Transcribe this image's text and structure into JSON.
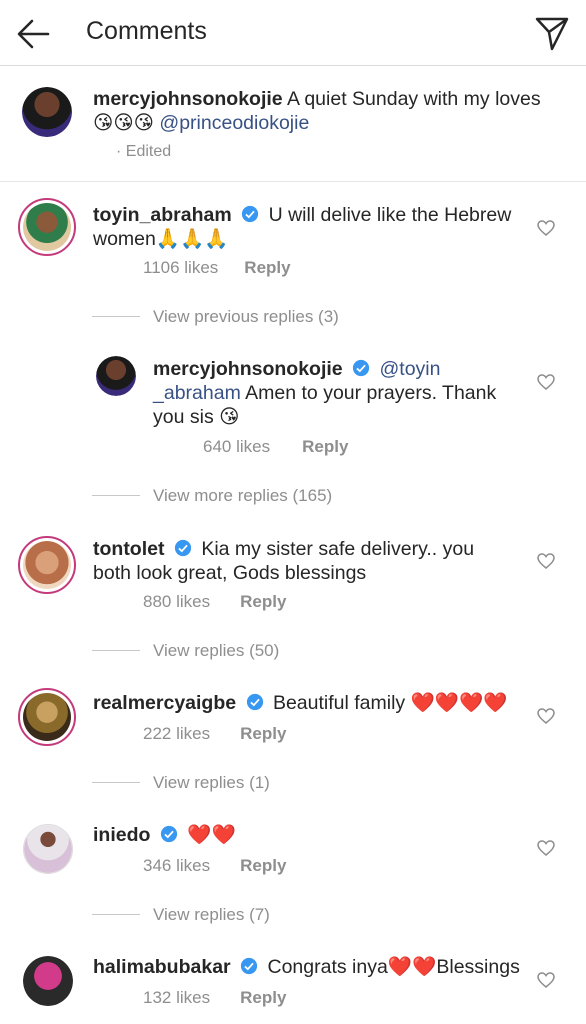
{
  "header": {
    "title": "Comments",
    "back_icon": "arrow-left-icon",
    "send_icon": "paper-plane-icon"
  },
  "caption": {
    "username": "mercyjohnsonokojie",
    "text": "A quiet Sunday with my loves",
    "emojis": "😘😘😘",
    "mention": "@princeodiokojie",
    "edited": "· Edited"
  },
  "comments": [
    {
      "username": "toyin_abraham",
      "verified": true,
      "text": "U will delive like the Hebrew",
      "text2": "women🙏🙏🙏",
      "likes": "1106 likes",
      "reply": "Reply",
      "view": "View previous replies (3)"
    },
    {
      "username": "mercyjohnsonokojie",
      "verified": true,
      "mention1": "@toyin",
      "mention2": "_abraham",
      "text": "Amen to your prayers. Thank",
      "text3": "you sis 😘",
      "likes": "640 likes",
      "reply": "Reply",
      "view": "View more replies (165)"
    },
    {
      "username": "tontolet",
      "verified": true,
      "text": "Kia my sister safe delivery.. you",
      "text2": "both look great, Gods blessings",
      "likes": "880 likes",
      "reply": "Reply",
      "view": "View replies (50)"
    },
    {
      "username": "realmercyaigbe",
      "verified": true,
      "text": "Beautiful family ❤️❤️❤️❤️",
      "likes": "222 likes",
      "reply": "Reply",
      "view": "View replies (1)"
    },
    {
      "username": "iniedo",
      "verified": true,
      "text": "❤️❤️",
      "likes": "346 likes",
      "reply": "Reply",
      "view": "View replies (7)"
    },
    {
      "username": "halimabubakar",
      "verified": true,
      "text": "Congrats inya❤️❤️Blessings",
      "likes": "132 likes",
      "reply": "Reply"
    }
  ],
  "colors": {
    "text": "#262626",
    "muted": "#8e8e8e",
    "link": "#385185",
    "verified": "#3897f0",
    "ring": "#c43a7a"
  }
}
